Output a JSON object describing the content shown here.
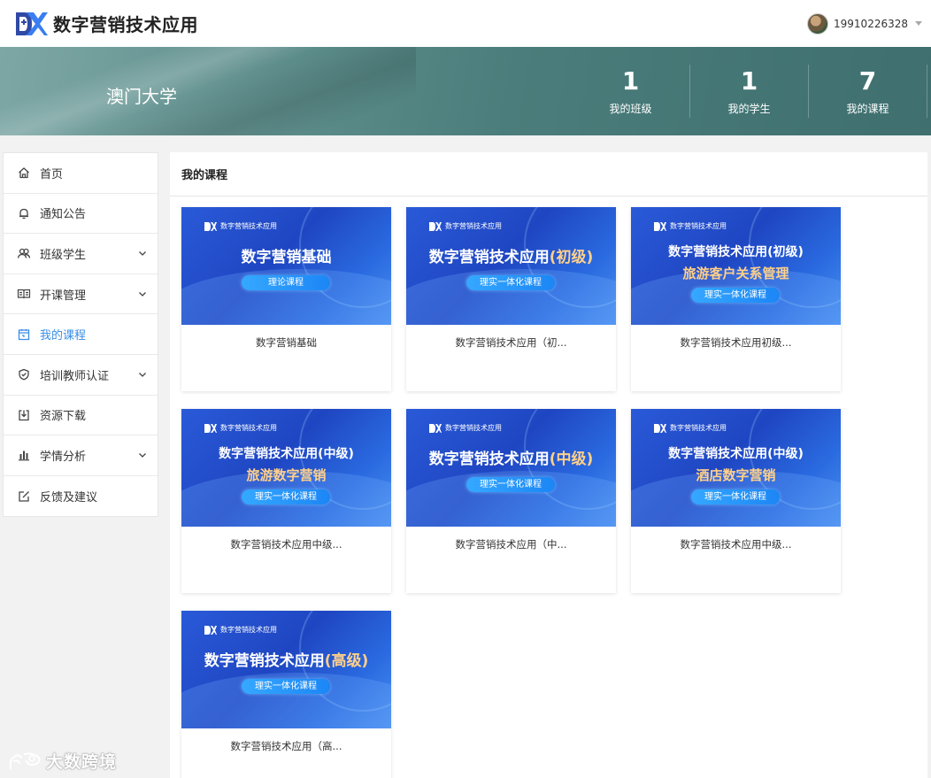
{
  "header": {
    "brand_title": "数字营销技术应用",
    "logo_icon": "dx-logo-icon",
    "user_name": "19910226328"
  },
  "banner": {
    "school": "澳门大学",
    "stats": [
      {
        "value": "1",
        "label": "我的班级"
      },
      {
        "value": "1",
        "label": "我的学生"
      },
      {
        "value": "7",
        "label": "我的课程"
      }
    ]
  },
  "sidebar": {
    "active_color": "#3a8ee6",
    "items": [
      {
        "label": "首页",
        "icon": "home-icon",
        "expandable": false,
        "active": false
      },
      {
        "label": "通知公告",
        "icon": "bell-icon",
        "expandable": false,
        "active": false
      },
      {
        "label": "班级学生",
        "icon": "users-icon",
        "expandable": true,
        "active": false
      },
      {
        "label": "开课管理",
        "icon": "book-icon",
        "expandable": true,
        "active": false
      },
      {
        "label": "我的课程",
        "icon": "calendar-icon",
        "expandable": false,
        "active": true
      },
      {
        "label": "培训教师认证",
        "icon": "shield-icon",
        "expandable": true,
        "active": false
      },
      {
        "label": "资源下载",
        "icon": "download-icon",
        "expandable": false,
        "active": false
      },
      {
        "label": "学情分析",
        "icon": "bar-chart-icon",
        "expandable": true,
        "active": false
      },
      {
        "label": "反馈及建议",
        "icon": "edit-icon",
        "expandable": false,
        "active": false
      }
    ]
  },
  "main": {
    "title": "我的课程",
    "thumb_brand": "数字营销技术应用",
    "courses": [
      {
        "name": "数字营销基础",
        "thumb_title": "数字营销基础",
        "thumb_title_2": "",
        "pill": "理论课程"
      },
      {
        "name": "数字营销技术应用（初...",
        "thumb_title": "数字营销技术应用",
        "thumb_level": "(初级)",
        "thumb_title_2": "",
        "pill": "理实一体化课程"
      },
      {
        "name": "数字营销技术应用初级...",
        "thumb_title": "数字营销技术应用(初级)",
        "thumb_title_2": "旅游客户关系管理",
        "pill": "理实一体化课程"
      },
      {
        "name": "数字营销技术应用中级...",
        "thumb_title": "数字营销技术应用(中级)",
        "thumb_title_2": "旅游数字营销",
        "pill": "理实一体化课程"
      },
      {
        "name": "数字营销技术应用（中...",
        "thumb_title": "数字营销技术应用",
        "thumb_level": "(中级)",
        "thumb_title_2": "",
        "pill": "理实一体化课程"
      },
      {
        "name": "数字营销技术应用中级...",
        "thumb_title": "数字营销技术应用(中级)",
        "thumb_title_2": "酒店数字营销",
        "pill": "理实一体化课程"
      },
      {
        "name": "数字营销技术应用（高...",
        "thumb_title": "数字营销技术应用",
        "thumb_level": "(高级)",
        "thumb_title_2": "",
        "pill": "理实一体化课程"
      }
    ]
  },
  "watermark": {
    "text": "大数跨境"
  }
}
